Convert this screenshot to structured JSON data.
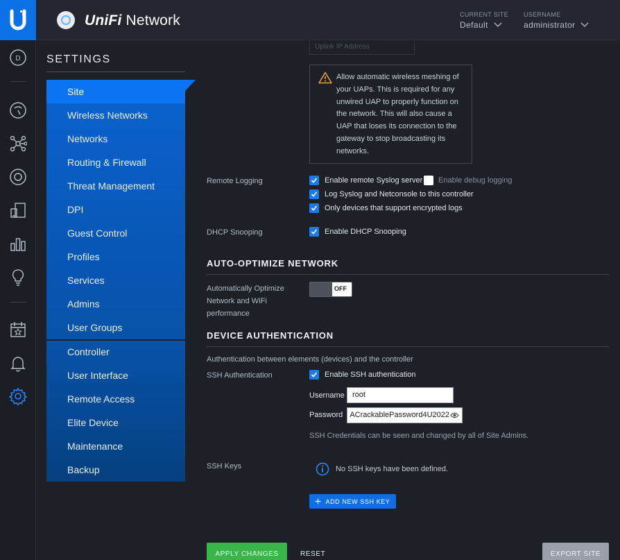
{
  "header": {
    "app_title_prefix": "UniFi",
    "app_title_suffix": " Network",
    "current_site_label": "CURRENT SITE",
    "current_site_value": "Default",
    "username_label": "USERNAME",
    "username_value": "administrator"
  },
  "rail": {
    "logo_letter": "U",
    "dashboard_letter": "D",
    "icons": [
      "statistics-icon",
      "topology-icon",
      "devices-icon",
      "clients-icon",
      "insights-icon",
      "events-icon",
      "calendar-icon",
      "alerts-icon",
      "settings-icon"
    ]
  },
  "settings_nav": {
    "title": "SETTINGS",
    "group1": [
      "Site",
      "Wireless Networks",
      "Networks",
      "Routing & Firewall",
      "Threat Management",
      "DPI",
      "Guest Control",
      "Profiles",
      "Services",
      "Admins",
      "User Groups"
    ],
    "group2": [
      "Controller",
      "User Interface",
      "Remote Access",
      "Elite Device",
      "Maintenance",
      "Backup"
    ],
    "active": "Site"
  },
  "main": {
    "uplink_placeholder": "Uplink IP Address",
    "mesh_warning": "Allow automatic wireless meshing of your UAPs. This is required for any unwired UAP to properly function on the network. This will also cause a UAP that loses its connection to the gateway to stop broadcasting its networks.",
    "remote_logging": {
      "label": "Remote Logging",
      "enable_syslog": "Enable remote Syslog server",
      "enable_syslog_checked": true,
      "enable_debug": "Enable debug logging",
      "enable_debug_checked": false,
      "log_to_controller": "Log Syslog and Netconsole to this controller",
      "log_to_controller_checked": true,
      "encrypted_only": "Only devices that support encrypted logs",
      "encrypted_only_checked": true
    },
    "dhcp_snooping": {
      "label": "DHCP Snooping",
      "option": "Enable DHCP Snooping",
      "checked": true
    },
    "auto_optimize": {
      "heading": "AUTO-OPTIMIZE NETWORK",
      "label_line1": "Automatically Optimize",
      "label_line2": "Network and WiFi",
      "label_line3": "performance",
      "toggle_state": "OFF"
    },
    "device_auth": {
      "heading": "DEVICE AUTHENTICATION",
      "description": "Authentication between elements (devices) and the controller",
      "ssh_label": "SSH Authentication",
      "ssh_enable": "Enable SSH authentication",
      "ssh_enable_checked": true,
      "username_label": "Username",
      "username_value": "root",
      "password_label": "Password",
      "password_value": "ACrackablePassword4U2022",
      "credentials_note": "SSH Credentials can be seen and changed by all of Site Admins.",
      "ssh_keys_label": "SSH Keys",
      "no_keys": "No SSH keys have been defined.",
      "add_key_button": "ADD NEW SSH KEY"
    },
    "actions": {
      "apply": "APPLY CHANGES",
      "reset": "RESET",
      "export": "EXPORT SITE"
    }
  },
  "colors": {
    "accent": "#0c73f2",
    "apply_green": "#3ab54a",
    "background": "#1d2027"
  }
}
